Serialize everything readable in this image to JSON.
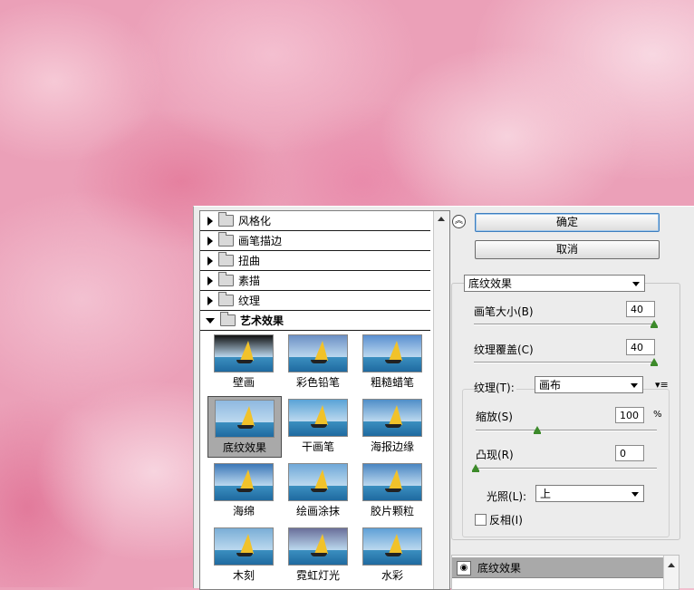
{
  "categories": [
    {
      "label": "风格化",
      "open": false
    },
    {
      "label": "画笔描边",
      "open": false
    },
    {
      "label": "扭曲",
      "open": false
    },
    {
      "label": "素描",
      "open": false
    },
    {
      "label": "纹理",
      "open": false
    },
    {
      "label": "艺术效果",
      "open": true
    }
  ],
  "thumbnails": [
    {
      "label": "壁画"
    },
    {
      "label": "彩色铅笔"
    },
    {
      "label": "粗糙蜡笔"
    },
    {
      "label": "底纹效果",
      "selected": true
    },
    {
      "label": "干画笔"
    },
    {
      "label": "海报边缘"
    },
    {
      "label": "海绵"
    },
    {
      "label": "绘画涂抹"
    },
    {
      "label": "胶片颗粒"
    },
    {
      "label": "木刻"
    },
    {
      "label": "霓虹灯光"
    },
    {
      "label": "水彩"
    }
  ],
  "buttons": {
    "ok": "确定",
    "cancel": "取消"
  },
  "filter_select": "底纹效果",
  "brush_size": {
    "label": "画笔大小(B)",
    "value": "40"
  },
  "texture_coverage": {
    "label": "纹理覆盖(C)",
    "value": "40"
  },
  "texture": {
    "label": "纹理(T):",
    "value": "画布"
  },
  "scaling": {
    "label": "缩放(S)",
    "value": "100",
    "unit": "%"
  },
  "relief": {
    "label": "凸现(R)",
    "value": "0"
  },
  "light": {
    "label": "光照(L):",
    "value": "上"
  },
  "invert": {
    "label": "反相(I)",
    "checked": false
  },
  "layer": {
    "label": "底纹效果"
  },
  "colors": {
    "accent": "#3d7ebf",
    "slider": "#3c8a2a",
    "background": "#eba0b8"
  }
}
